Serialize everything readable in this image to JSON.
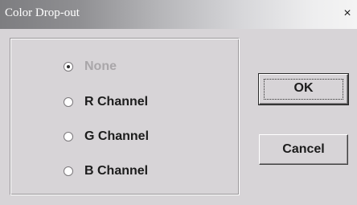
{
  "window": {
    "title": "Color Drop-out",
    "close_label": "×"
  },
  "options": {
    "selected": "None",
    "items": [
      {
        "label": "None",
        "checked": true,
        "disabled": true
      },
      {
        "label": "R Channel",
        "checked": false,
        "disabled": false
      },
      {
        "label": "G Channel",
        "checked": false,
        "disabled": false
      },
      {
        "label": "B Channel",
        "checked": false,
        "disabled": false
      }
    ]
  },
  "buttons": {
    "ok_label": "OK",
    "cancel_label": "Cancel"
  },
  "colors": {
    "dialog_bg": "#d7d4d7",
    "title_text": "#ffffff",
    "disabled_text": "#a9a6a9"
  }
}
